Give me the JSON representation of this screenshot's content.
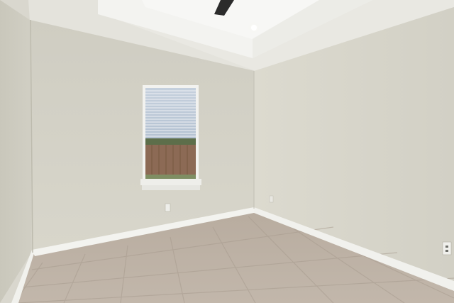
{
  "scene": {
    "kind": "photo",
    "subject": "empty-room",
    "colors": {
      "wall_left": "#cfcdc1",
      "wall_back": "#d6d4c8",
      "wall_right": "#d9d7cb",
      "ceiling": "#ecebe5",
      "tray_ceiling": "#f4f4f1",
      "baseboard": "#f3f3ef",
      "floor_tile": "#b9ada0",
      "grout": "#a79b8e",
      "window_frame": "#f2f2ef",
      "blinds": "#dfe3ea",
      "sky": "#b9c7d6",
      "fence": "#8c6a55",
      "grass": "#7f8e63",
      "fan_blade": "#2b2b2b"
    },
    "objects": [
      "ceiling-fan-icon",
      "recessed-light-icon",
      "window-icon",
      "electrical-outlet-icon"
    ]
  }
}
